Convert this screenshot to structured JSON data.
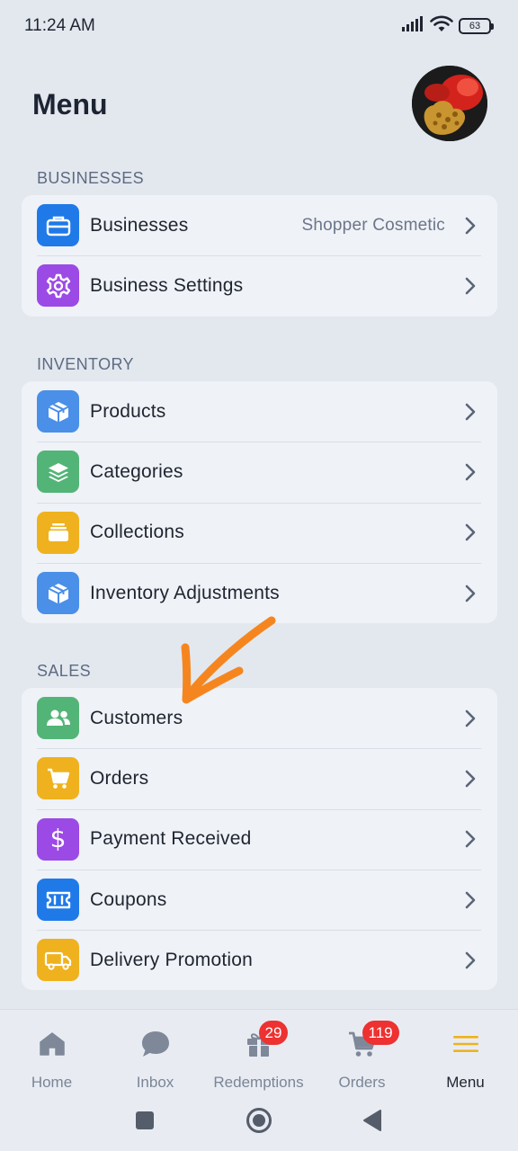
{
  "status_bar": {
    "time": "11:24 AM",
    "battery": "63"
  },
  "header": {
    "title": "Menu"
  },
  "sections": {
    "businesses": {
      "title": "BUSINESSES",
      "items": [
        {
          "label": "Businesses",
          "value": "Shopper Cosmetic",
          "icon": "briefcase-icon"
        },
        {
          "label": "Business Settings",
          "icon": "gear-icon"
        }
      ]
    },
    "inventory": {
      "title": "INVENTORY",
      "items": [
        {
          "label": "Products",
          "icon": "box-icon"
        },
        {
          "label": "Categories",
          "icon": "layers-icon"
        },
        {
          "label": "Collections",
          "icon": "collection-icon"
        },
        {
          "label": "Inventory Adjustments",
          "icon": "box-icon"
        }
      ]
    },
    "sales": {
      "title": "SALES",
      "items": [
        {
          "label": "Customers",
          "icon": "users-icon"
        },
        {
          "label": "Orders",
          "icon": "cart-icon"
        },
        {
          "label": "Payment Received",
          "icon": "dollar-icon"
        },
        {
          "label": "Coupons",
          "icon": "ticket-icon"
        },
        {
          "label": "Delivery Promotion",
          "icon": "truck-icon"
        }
      ]
    }
  },
  "bottom_nav": {
    "items": [
      {
        "label": "Home",
        "icon": "home-icon"
      },
      {
        "label": "Inbox",
        "icon": "chat-icon"
      },
      {
        "label": "Redemptions",
        "icon": "gift-icon",
        "badge": "29"
      },
      {
        "label": "Orders",
        "icon": "cart-icon",
        "badge": "119"
      },
      {
        "label": "Menu",
        "icon": "menu-icon",
        "active": true
      }
    ]
  },
  "colors": {
    "background": "#e3e8ef",
    "card": "#eff2f7",
    "accent_blue": "#1f7ae8",
    "accent_purple": "#9b4ae6",
    "accent_green": "#53b478",
    "accent_amber": "#efb21e",
    "badge_red": "#ee3131",
    "annotation_orange": "#f5861f"
  }
}
